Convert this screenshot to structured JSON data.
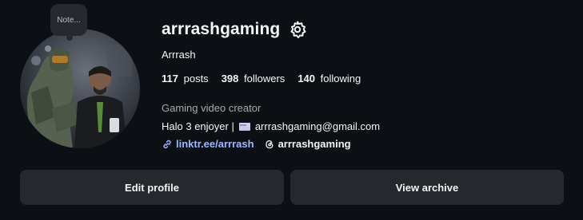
{
  "profile": {
    "note_label": "Note...",
    "username": "arrrashgaming",
    "full_name": "Arrrash",
    "stats": [
      {
        "count": "117",
        "label": "posts"
      },
      {
        "count": "398",
        "label": "followers"
      },
      {
        "count": "140",
        "label": "following"
      }
    ],
    "category": "Gaming video creator",
    "bio_prefix": "Halo 3 enjoyer |",
    "bio_email": "arrrashgaming@gmail.com",
    "link_external": "linktr.ee/arrrash",
    "link_threads": "arrrashgaming"
  },
  "actions": {
    "edit_label": "Edit profile",
    "archive_label": "View archive"
  },
  "icons": {
    "settings": "gear-icon",
    "link": "link-icon",
    "threads": "threads-icon",
    "email_emoji": "envelope-emoji-icon"
  },
  "colors": {
    "background": "#0c1014",
    "button_bg": "#25292e",
    "link_blue": "#9db8ff",
    "muted_text": "#a8a8a8"
  }
}
